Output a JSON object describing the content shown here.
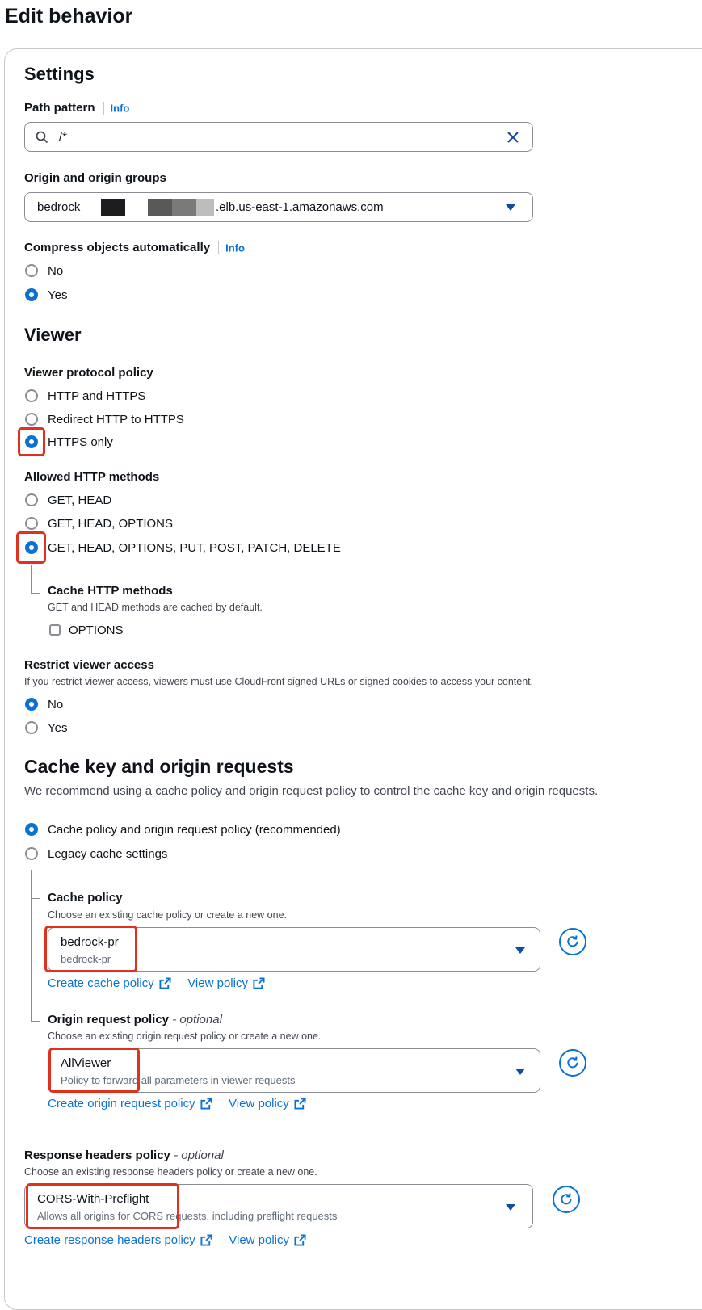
{
  "page_title": "Edit behavior",
  "info_label": "Info",
  "settings": {
    "heading": "Settings",
    "path_pattern": {
      "label": "Path pattern",
      "value": "/*"
    },
    "origin": {
      "label": "Origin and origin groups",
      "value_prefix": "bedrock",
      "value_suffix": ".elb.us-east-1.amazonaws.com"
    },
    "compress": {
      "label": "Compress objects automatically",
      "options": [
        "No",
        "Yes"
      ],
      "selected": "Yes"
    }
  },
  "viewer": {
    "heading": "Viewer",
    "protocol": {
      "label": "Viewer protocol policy",
      "options": [
        "HTTP and HTTPS",
        "Redirect HTTP to HTTPS",
        "HTTPS only"
      ],
      "selected": "HTTPS only"
    },
    "methods": {
      "label": "Allowed HTTP methods",
      "options": [
        "GET, HEAD",
        "GET, HEAD, OPTIONS",
        "GET, HEAD, OPTIONS, PUT, POST, PATCH, DELETE"
      ],
      "selected": "GET, HEAD, OPTIONS, PUT, POST, PATCH, DELETE"
    },
    "cache_methods": {
      "label": "Cache HTTP methods",
      "description": "GET and HEAD methods are cached by default.",
      "option": "OPTIONS",
      "checked": false
    },
    "restrict": {
      "label": "Restrict viewer access",
      "description": "If you restrict viewer access, viewers must use CloudFront signed URLs or signed cookies to access your content.",
      "options": [
        "No",
        "Yes"
      ],
      "selected": "No"
    }
  },
  "cache": {
    "heading": "Cache key and origin requests",
    "description": "We recommend using a cache policy and origin request policy to control the cache key and origin requests.",
    "options": [
      "Cache policy and origin request policy (recommended)",
      "Legacy cache settings"
    ],
    "selected": "Cache policy and origin request policy (recommended)",
    "cache_policy": {
      "label": "Cache policy",
      "description": "Choose an existing cache policy or create a new one.",
      "value": "bedrock-pr",
      "value_description": "bedrock-pr",
      "create_link": "Create cache policy",
      "view_link": "View policy"
    },
    "origin_request_policy": {
      "label": "Origin request policy",
      "optional": "- optional",
      "description": "Choose an existing origin request policy or create a new one.",
      "value": "AllViewer",
      "value_description": "Policy to forward all parameters in viewer requests",
      "create_link": "Create origin request policy",
      "view_link": "View policy"
    },
    "response_headers_policy": {
      "label": "Response headers policy",
      "optional": "- optional",
      "description": "Choose an existing response headers policy or create a new one.",
      "value": "CORS-With-Preflight",
      "value_description": "Allows all origins for CORS requests, including preflight requests",
      "create_link": "Create response headers policy",
      "view_link": "View policy"
    }
  },
  "colors": {
    "accent": "#0972d3",
    "highlight": "#e0301e",
    "text": "#0f141a"
  }
}
